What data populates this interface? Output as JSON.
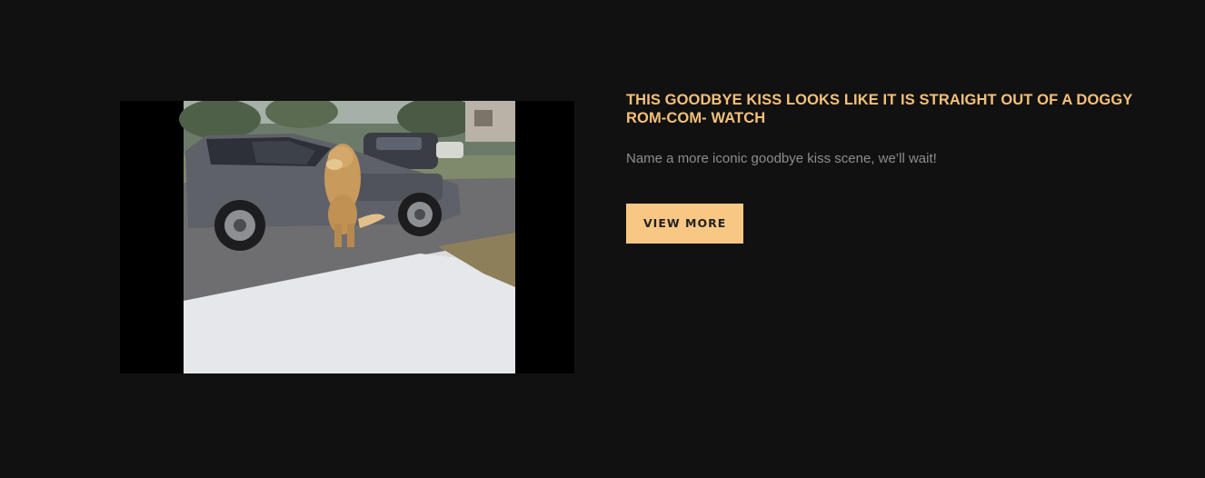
{
  "post": {
    "title": "THIS GOODBYE KISS LOOKS LIKE IT IS STRAIGHT OUT OF A DOGGY ROM-COM- WATCH",
    "excerpt": "Name a more iconic goodbye kiss scene, we’ll wait!",
    "button_label": "VIEW MORE",
    "thumbnail_icon": "video-thumbnail"
  },
  "colors": {
    "background": "#111111",
    "title": "#f5c07a",
    "excerpt": "#8d8d8d",
    "button_bg": "#f9c784",
    "button_text": "#222222"
  }
}
